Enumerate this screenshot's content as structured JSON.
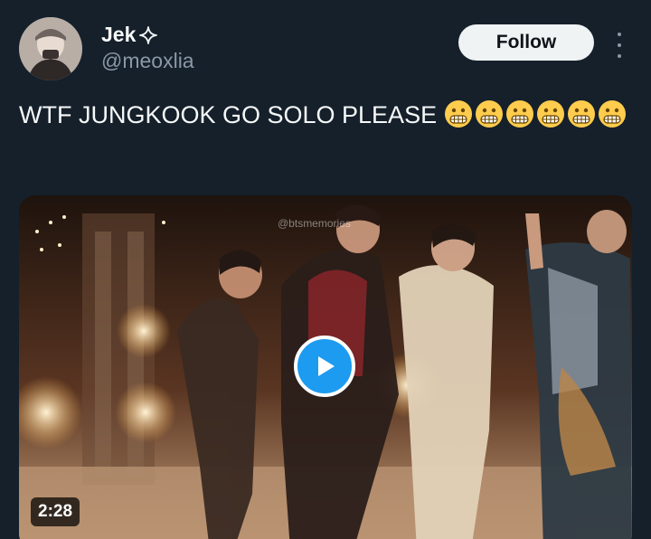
{
  "author": {
    "display_name": "Jek",
    "sparkle_icon": "four-point-star-icon",
    "handle": "@meoxlia"
  },
  "actions": {
    "follow_label": "Follow",
    "more_icon": "vertical-ellipsis-icon"
  },
  "tweet": {
    "text": "WTF JUNGKOOK GO SOLO PLEASE",
    "emoji_name": "grimacing-face",
    "emoji_count": 6
  },
  "media": {
    "watermark": "@btsmemories",
    "duration": "2:28",
    "play_icon": "play-icon"
  },
  "colors": {
    "background": "#15202b",
    "accent": "#1d9bf0",
    "handle": "#8b98a5"
  }
}
